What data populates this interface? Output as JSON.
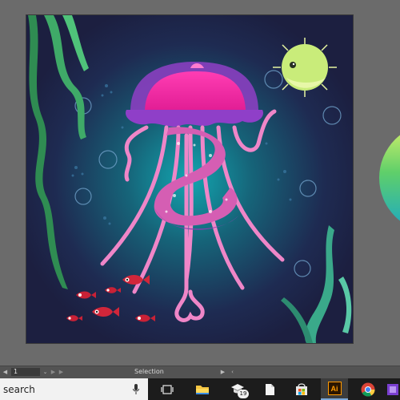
{
  "statusbar": {
    "zoom_value": "1",
    "current_tool": "Selection"
  },
  "taskbar": {
    "search_placeholder": "search",
    "store_badge": "19",
    "illustrator_label": "Ai"
  },
  "colors": {
    "pasteboard": "#6b6b6b",
    "artboard_bg": "#1f2346",
    "jelly_bell": "#ff2fa6",
    "tentacles": "#ef86c8",
    "seaweed": "#3fa866",
    "pufferfish": "#c9ec7a",
    "illustrator_orange": "#ff9a00"
  }
}
